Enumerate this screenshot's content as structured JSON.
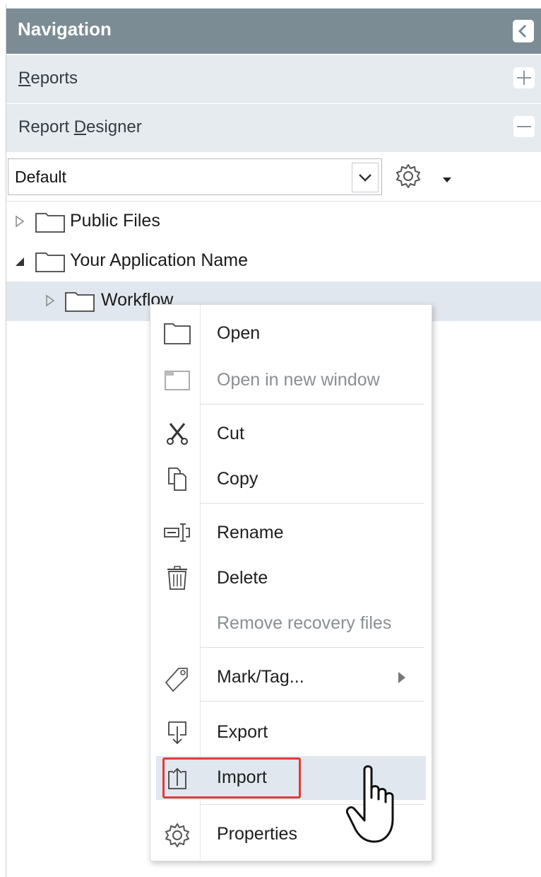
{
  "panel": {
    "title": "Navigation"
  },
  "sections": [
    {
      "label_prefix": "",
      "label_accel": "R",
      "label_rest": "eports",
      "button": "+"
    },
    {
      "label_prefix": "Report ",
      "label_accel": "D",
      "label_rest": "esigner",
      "button": "−"
    }
  ],
  "filter": {
    "value": "Default"
  },
  "tree": [
    {
      "label": "Public Files",
      "expanded": false
    },
    {
      "label": "Your Application Name",
      "expanded": true
    },
    {
      "label": "Workflow",
      "expanded": false,
      "selected": true
    }
  ],
  "context_menu": {
    "items": [
      {
        "label": "Open",
        "icon": "folder-icon",
        "enabled": true
      },
      {
        "label": "Open in new window",
        "icon": "new-window-icon",
        "enabled": false
      },
      {
        "label": "Cut",
        "icon": "scissors-icon",
        "enabled": true
      },
      {
        "label": "Copy",
        "icon": "copy-icon",
        "enabled": true
      },
      {
        "label": "Rename",
        "icon": "rename-icon",
        "enabled": true
      },
      {
        "label": "Delete",
        "icon": "trash-icon",
        "enabled": true
      },
      {
        "label": "Remove recovery files",
        "icon": "",
        "enabled": false
      },
      {
        "label": "Mark/Tag...",
        "icon": "tag-icon",
        "enabled": true,
        "submenu": true
      },
      {
        "label": "Export",
        "icon": "export-icon",
        "enabled": true
      },
      {
        "label": "Import",
        "icon": "import-icon",
        "enabled": true,
        "hovered": true,
        "highlighted": true
      },
      {
        "label": "Properties",
        "icon": "gear-icon",
        "enabled": true
      }
    ]
  },
  "colors": {
    "header_bg": "#7b8c95",
    "section_bg": "#e6ebf0",
    "selection_bg": "#e1e7ee",
    "highlight_border": "#e03a3a"
  }
}
